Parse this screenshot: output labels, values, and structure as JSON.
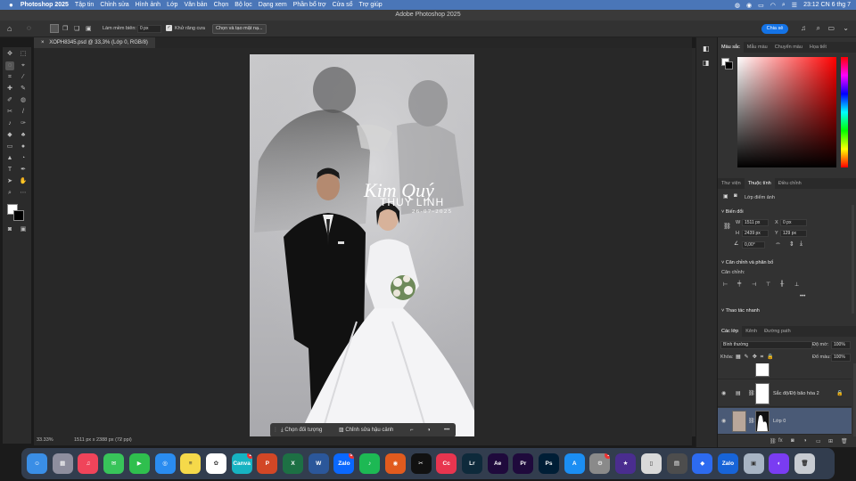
{
  "menubar": {
    "app": "Photoshop 2025",
    "items": [
      "Tập tin",
      "Chỉnh sửa",
      "Hình ảnh",
      "Lớp",
      "Văn bản",
      "Chọn",
      "Bộ lọc",
      "Dạng xem",
      "Phần bổ trợ",
      "Cửa sổ",
      "Trợ giúp"
    ],
    "clock": "23:12 CN 6 thg 7"
  },
  "titlebar": {
    "title": "Adobe Photoshop 2025"
  },
  "options": {
    "feather_label": "Làm mềm biên:",
    "feather_value": "0 px",
    "antialias_label": "Khử răng cưa",
    "select_mask_label": "Chọn và tạo mặt nạ...",
    "share_label": "Chia sẻ"
  },
  "document": {
    "tab_label": "XOPH8345.psd @ 33,3% (Lớp 0, RGB/8)",
    "zoom": "33.33%",
    "doc_info": "1511 px x 2388 px (72 ppi)"
  },
  "photo": {
    "script_text": "Kim Quý",
    "name_text": "THUY LINH",
    "date_text": "26-07-2025"
  },
  "context_bar": {
    "select_subject": "Chọn đối tượng",
    "remove_bg": "Chỉnh sửa hậu cảnh",
    "more": "•••"
  },
  "color_panel": {
    "tabs": [
      "Màu sắc",
      "Mẫu màu",
      "Chuyển màu",
      "Họa tiết"
    ]
  },
  "props_panel": {
    "tabs": [
      "Thư viện",
      "Thuộc tính",
      "Điều chỉnh"
    ],
    "layer_type": "Lớp điểm ảnh",
    "transform_title": "Biến đổi",
    "w_label": "W",
    "w_value": "1511 px",
    "h_label": "H",
    "h_value": "2439 px",
    "x_label": "X",
    "x_value": "0 px",
    "y_label": "Y",
    "y_value": "129 px",
    "angle_value": "0,00°",
    "align_title": "Căn chỉnh và phân bố",
    "align_label": "Căn chỉnh:",
    "quick_actions": "Thao tác nhanh",
    "more": "•••"
  },
  "layers_panel": {
    "tabs": [
      "Các lớp",
      "Kênh",
      "Đường path"
    ],
    "blend_mode": "Bình thường",
    "opacity_label": "Độ mờ:",
    "opacity_value": "100%",
    "lock_label": "Khóa:",
    "fill_label": "Đổ màu:",
    "fill_value": "100%",
    "layers": [
      {
        "name": ""
      },
      {
        "name": "Sắc độ/Độ bão hòa 2"
      },
      {
        "name": "Lớp 0"
      }
    ],
    "footer_fx": "fx"
  },
  "dock": {
    "apps": [
      {
        "name": "Finder",
        "label": "☺",
        "color": "#3a8ee6"
      },
      {
        "name": "Launchpad",
        "label": "▦",
        "color": "#8e8e9e"
      },
      {
        "name": "Music",
        "label": "♫",
        "color": "#f0445a"
      },
      {
        "name": "Messages",
        "label": "✉",
        "color": "#38c45a"
      },
      {
        "name": "FaceTime",
        "label": "▶",
        "color": "#2fbf4e"
      },
      {
        "name": "Safari",
        "label": "◎",
        "color": "#2a8cf0"
      },
      {
        "name": "Notes",
        "label": "≡",
        "color": "#f5d94a"
      },
      {
        "name": "Photos",
        "label": "✿",
        "color": "#ffffff"
      },
      {
        "name": "Canva",
        "label": "Canva",
        "color": "#17b3c2",
        "badge": "1"
      },
      {
        "name": "PowerPoint",
        "label": "P",
        "color": "#d24726"
      },
      {
        "name": "Excel",
        "label": "X",
        "color": "#1d7044"
      },
      {
        "name": "Word",
        "label": "W",
        "color": "#2b579a"
      },
      {
        "name": "Zalo",
        "label": "Zalo",
        "color": "#0a68ff",
        "badge": "5+"
      },
      {
        "name": "Spotify",
        "label": "♪",
        "color": "#1db954"
      },
      {
        "name": "Podcast",
        "label": "◉",
        "color": "#e15b1e"
      },
      {
        "name": "CapCut",
        "label": "✂",
        "color": "#111111"
      },
      {
        "name": "Creative Cloud",
        "label": "Cc",
        "color": "#e8354f"
      },
      {
        "name": "Lightroom",
        "label": "Lr",
        "color": "#0e2a3b"
      },
      {
        "name": "After Effects",
        "label": "Ae",
        "color": "#1f0a3c"
      },
      {
        "name": "Premiere",
        "label": "Pr",
        "color": "#1f0a3c"
      },
      {
        "name": "Photoshop",
        "label": "Ps",
        "color": "#001e36"
      },
      {
        "name": "App Store",
        "label": "A",
        "color": "#1b8ef3"
      },
      {
        "name": "System Settings",
        "label": "⚙",
        "color": "#8a8a8a",
        "badge": "1"
      },
      {
        "name": "iMovie",
        "label": "★",
        "color": "#4a2d8f"
      },
      {
        "name": "iPhone Mirroring",
        "label": "▯",
        "color": "#d9d9d9"
      },
      {
        "name": "Calculator",
        "label": "▤",
        "color": "#4d4d4d"
      },
      {
        "name": "Roblox",
        "label": "◆",
        "color": "#2d6bf0"
      },
      {
        "name": "Zalo Files",
        "label": "Zalo",
        "color": "#1764d8"
      },
      {
        "name": "Preview",
        "label": "▣",
        "color": "#a7b4c4"
      },
      {
        "name": "Messenger",
        "label": "◐",
        "color": "#7a3cf2"
      },
      {
        "name": "Trash",
        "label": "🗑",
        "color": "#c7cbd1"
      }
    ]
  }
}
